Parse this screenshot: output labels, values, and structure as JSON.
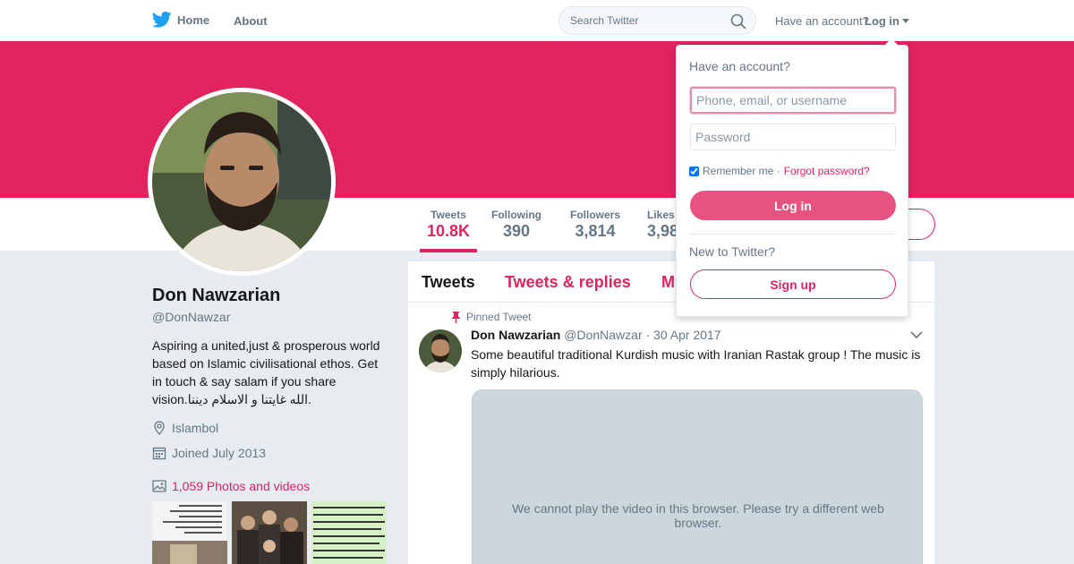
{
  "nav": {
    "home_label": "Home",
    "about_label": "About",
    "search_placeholder": "Search Twitter",
    "have_account": "Have an account?",
    "login_label": "Log in"
  },
  "profile": {
    "name": "Don Nawzarian",
    "handle": "@DonNawzar",
    "bio": "Aspiring a united,just & prosperous world based on Islamic civilisational ethos. Get in touch & say salam if you share vision.الله غايتنا و الاسلام ديننا.",
    "location": "Islambol",
    "joined": "Joined July 2013",
    "photos_label": "1,059 Photos and videos"
  },
  "stats": [
    {
      "label": "Tweets",
      "value": "10.8K"
    },
    {
      "label": "Following",
      "value": "390"
    },
    {
      "label": "Followers",
      "value": "3,814"
    },
    {
      "label": "Likes",
      "value": "3,98"
    }
  ],
  "timeline": {
    "tabs": [
      "Tweets",
      "Tweets & replies",
      "M"
    ],
    "pinned_label": "Pinned Tweet",
    "tweet": {
      "author": "Don Nawzarian",
      "handle": "@DonNawzar",
      "date": "· 30 Apr 2017",
      "text": "Some beautiful traditional Kurdish music with Iranian Rastak group ! The music is simply hilarious.",
      "video_message": "We cannot play the video in this browser. Please try a different web browser."
    }
  },
  "login_dropdown": {
    "title": "Have an account?",
    "username_placeholder": "Phone, email, or username",
    "password_placeholder": "Password",
    "remember_label": "Remember me ·",
    "forgot_label": "Forgot password?",
    "login_button": "Log in",
    "new_label": "New to Twitter?",
    "signup_button": "Sign up"
  },
  "colors": {
    "accent": "#e0245e",
    "twitter_blue": "#1da1f2",
    "banner": "#e0245e"
  }
}
